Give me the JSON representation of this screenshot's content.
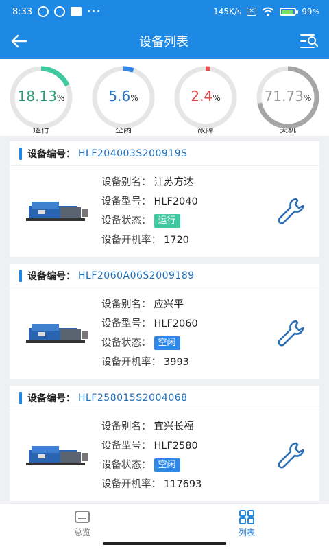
{
  "status_bar": {
    "time": "8:33",
    "net_speed": "145K/s",
    "battery": "99"
  },
  "header": {
    "title": "设备列表"
  },
  "stats": [
    {
      "value": "18.13",
      "unit": "%",
      "label": "运行",
      "color": "#3ec9a0",
      "progress": 0.1813
    },
    {
      "value": "5.6",
      "unit": "%",
      "label": "空闲",
      "color": "#2f88e8",
      "progress": 0.056
    },
    {
      "value": "2.4",
      "unit": "%",
      "label": "故障",
      "color": "#e85050",
      "progress": 0.024
    },
    {
      "value": "71.73",
      "unit": "%",
      "label": "关机",
      "color": "#a6a6a6",
      "progress": 0.7173
    }
  ],
  "field_labels": {
    "code": "设备编号：",
    "alias": "设备别名：",
    "model": "设备型号：",
    "status": "设备状态：",
    "rate": "设备开机率："
  },
  "devices": [
    {
      "code": "HLF204003S200919S",
      "alias": "江苏方达",
      "model": "HLF2040",
      "status": "运行",
      "status_color": "#3ec9a0",
      "rate": "1720"
    },
    {
      "code": "HLF2060A06S2009189",
      "alias": "应兴平",
      "model": "HLF2060",
      "status": "空闲",
      "status_color": "#2f88e8",
      "rate": "3993"
    },
    {
      "code": "HLF258015S2004068",
      "alias": "宜兴长福",
      "model": "HLF2580",
      "status": "空闲",
      "status_color": "#2f88e8",
      "rate": "117693"
    }
  ],
  "bottom_nav": [
    {
      "label": "总览",
      "icon": "overview-icon",
      "active": false
    },
    {
      "label": "列表",
      "icon": "grid-list-icon",
      "active": true
    }
  ],
  "colors": {
    "primary": "#1e88e5",
    "running": "#3ec9a0",
    "idle": "#2f88e8",
    "fault": "#e85050",
    "off": "#a6a6a6"
  }
}
